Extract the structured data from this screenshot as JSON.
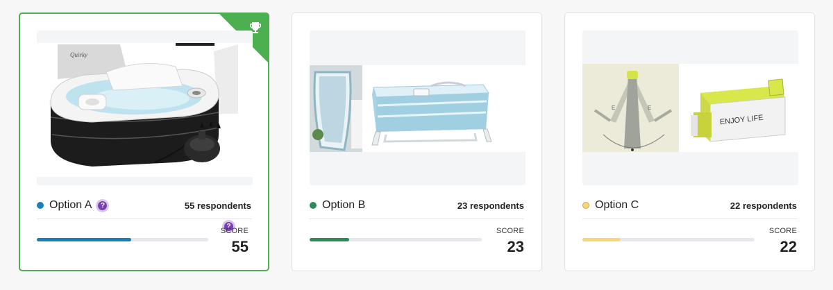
{
  "cards": [
    {
      "option_label": "Option A",
      "respondents": "55 respondents",
      "score_label": "SCORE",
      "score": "55",
      "score_fraction": 0.55,
      "dot_color": "#1a80b8",
      "bar_color": "#1a7db5",
      "winner": true,
      "winner_icon": "trophy-icon",
      "help_icon": "question-icon",
      "help_glyph": "?",
      "image_desc_icon": "inflatable-bathtub-product-image",
      "image_logo_text": "Quirky"
    },
    {
      "option_label": "Option B",
      "respondents": "23 respondents",
      "score_label": "SCORE",
      "score": "23",
      "score_fraction": 0.23,
      "dot_color": "#2e8b57",
      "bar_color": "#2e8b57",
      "winner": false,
      "image_desc_icon": "foldable-bathtub-product-image"
    },
    {
      "option_label": "Option C",
      "respondents": "22 respondents",
      "score_label": "SCORE",
      "score": "22",
      "score_fraction": 0.22,
      "dot_color": "#f5d67a",
      "bar_color": "#f5d67a",
      "winner": false,
      "image_desc_icon": "collapsible-bathtub-product-image",
      "image_text": "ENJOY LIFE"
    }
  ]
}
